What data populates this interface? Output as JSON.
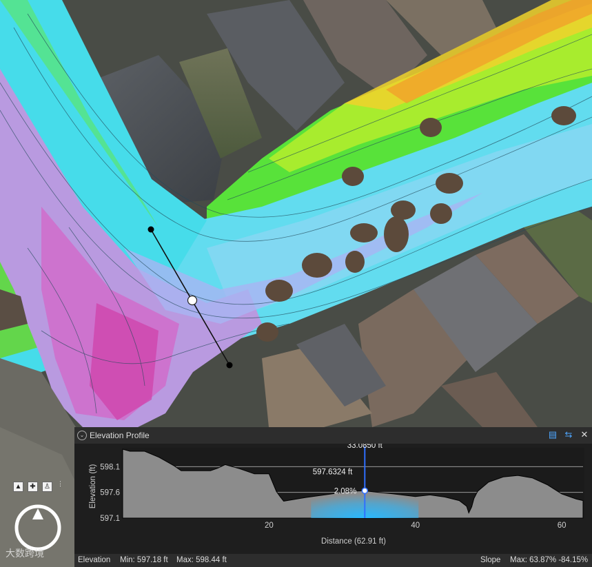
{
  "profile_panel": {
    "title": "Elevation Profile",
    "cursor_distance": "33.0850 ft",
    "cursor_elevation": "597.6324 ft",
    "cursor_slope": "2.08%",
    "y_axis_label": "Elevation (ft)",
    "x_axis_label": "Distance (62.91 ft)",
    "toolbar_icons": [
      "chart-options-icon",
      "swap-direction-icon",
      "close-icon"
    ]
  },
  "status_bar": {
    "elevation_label": "Elevation",
    "min_text": "Min: 597.18 ft",
    "max_text": "Max: 598.44 ft",
    "slope_label": "Slope",
    "slope_text": "Max: 63.87%  -84.15%"
  },
  "map_controls": {
    "nav_icons": [
      "pan-up-icon",
      "full-extent-icon",
      "walk-mode-icon",
      "options-icon"
    ],
    "compass": "compass-icon"
  },
  "watermark": "大数跨境",
  "colors": {
    "profile_fill": "#8c8c8c",
    "cursor_line": "#2f6fff",
    "highlight": "#28b8ff",
    "panel_bg": "#1e1e1e"
  },
  "chart_data": {
    "type": "area",
    "xlabel": "Distance (62.91 ft)",
    "ylabel": "Elevation (ft)",
    "xlim": [
      0,
      62.91
    ],
    "ylim": [
      597.1,
      598.44
    ],
    "x_ticks": [
      20,
      40,
      60
    ],
    "y_ticks": [
      597.1,
      597.6,
      598.1
    ],
    "x_tick_labels": [
      "20",
      "40",
      "60"
    ],
    "y_tick_labels": [
      "597.1",
      "597.6",
      "598.1"
    ],
    "grid": "horizontal",
    "cursor": {
      "x": 33.085,
      "y": 597.6324,
      "slope": "2.08%"
    },
    "x": [
      0,
      1,
      3,
      5,
      6,
      7,
      8,
      8.5,
      9,
      10,
      12,
      13,
      14,
      16,
      18,
      20,
      21,
      21.5,
      22,
      25,
      28,
      30,
      31,
      33,
      35,
      37,
      40,
      42,
      44,
      46,
      47,
      47.3,
      47.7,
      48,
      48.5,
      50,
      52,
      54,
      56,
      58,
      60,
      62,
      62.91
    ],
    "y": [
      598.44,
      598.4,
      598.4,
      598.28,
      598.2,
      598.12,
      598.02,
      598.02,
      598.02,
      598.02,
      598.02,
      598.07,
      598.14,
      598.06,
      597.96,
      597.96,
      597.62,
      597.52,
      597.43,
      597.5,
      597.56,
      597.6,
      597.62,
      597.63,
      597.6,
      597.57,
      597.52,
      597.55,
      597.51,
      597.44,
      597.33,
      597.2,
      597.32,
      597.48,
      597.62,
      597.8,
      597.9,
      597.93,
      597.88,
      597.75,
      597.57,
      597.47,
      597.44
    ]
  }
}
